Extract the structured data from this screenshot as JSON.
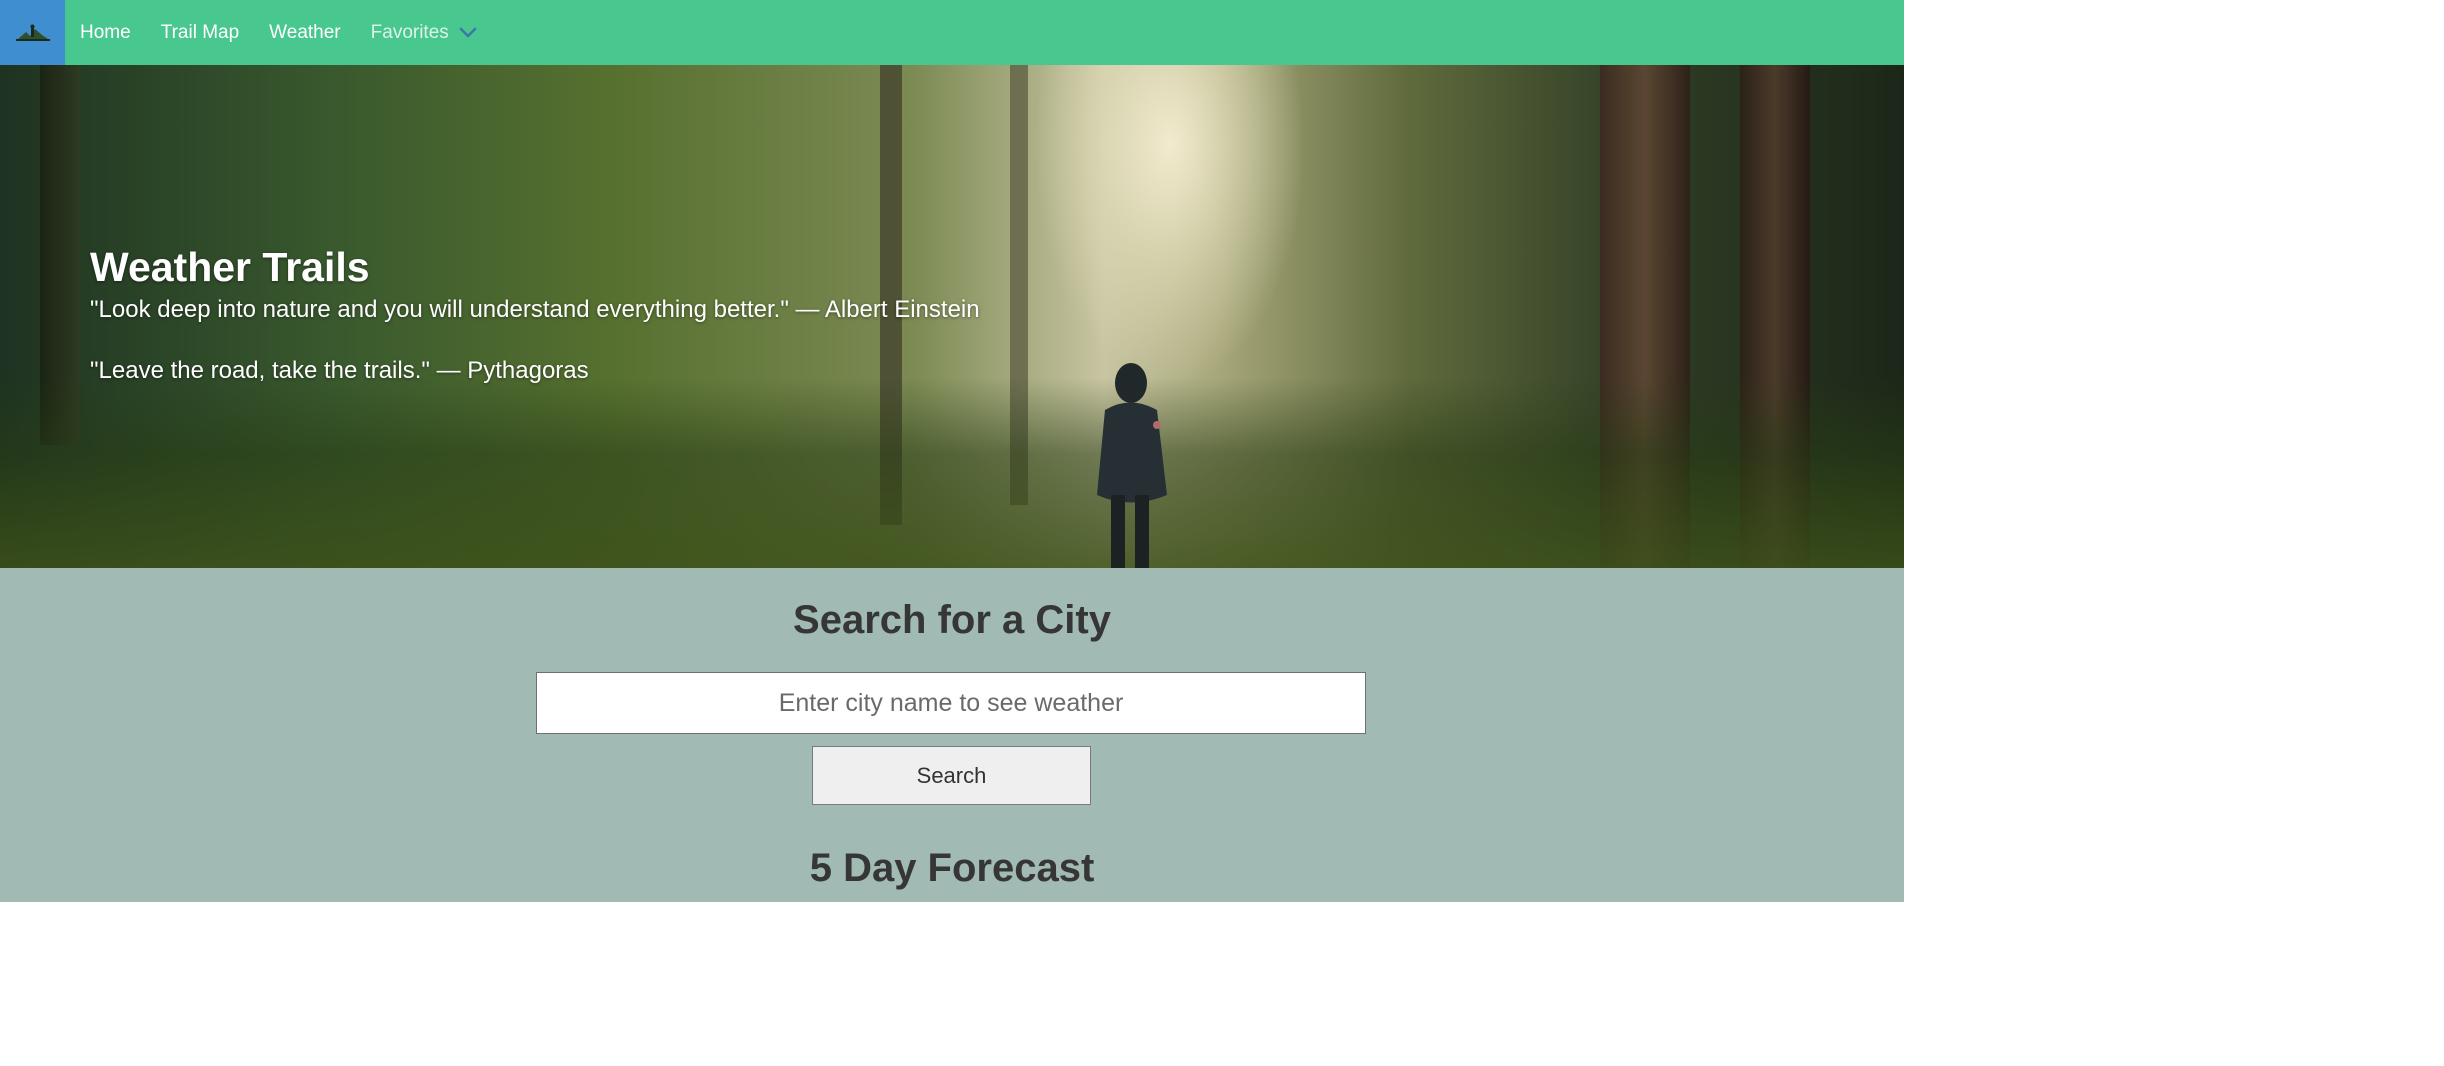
{
  "navbar": {
    "brand_icon": "hiker-logo-icon",
    "items": [
      {
        "label": "Home"
      },
      {
        "label": "Trail Map"
      },
      {
        "label": "Weather"
      }
    ],
    "dropdown": {
      "label": "Favorites",
      "icon": "chevron-down-icon"
    }
  },
  "hero": {
    "title": "Weather Trails",
    "quote1": "\"Look deep into nature and you will understand everything better.\" — Albert Einstein",
    "quote2": "\"Leave the road, take the trails.\" — Pythagoras"
  },
  "search": {
    "title": "Search for a City",
    "placeholder": "Enter city name to see weather",
    "button_label": "Search"
  },
  "forecast": {
    "title": "5 Day Forecast"
  },
  "colors": {
    "navbar": "#48c78e",
    "brand": "#3e8ed0",
    "section": "#a1bab4",
    "heading": "#363636"
  }
}
